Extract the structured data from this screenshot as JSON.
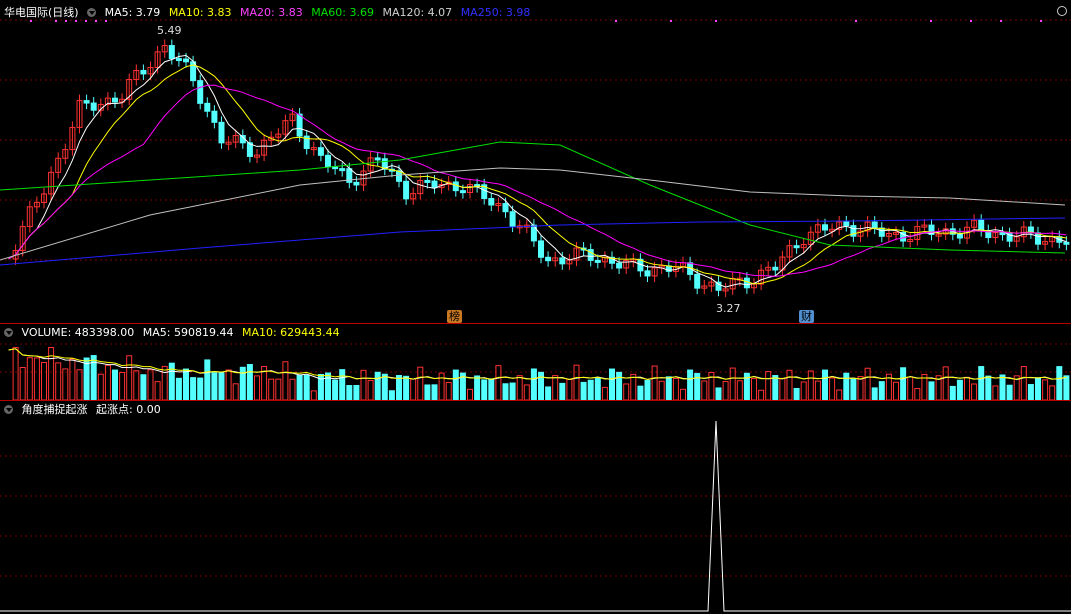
{
  "price": {
    "title": "华电国际(日线)",
    "ma5": "MA5: 3.79",
    "ma10": "MA10: 3.83",
    "ma20": "MA20: 3.83",
    "ma60": "MA60: 3.69",
    "ma120": "MA120: 4.07",
    "ma250": "MA250: 3.98",
    "high_label": "5.49",
    "low_label": "3.27",
    "tag1": "榜",
    "tag2": "财"
  },
  "volume": {
    "title": "VOLUME: 483398.00",
    "ma5": "MA5: 590819.44",
    "ma10": "MA10: 629443.44"
  },
  "indicator": {
    "title": "角度捕捉起涨",
    "value": "起涨点: 0.00"
  },
  "colors": {
    "up": "#ff3232",
    "down": "#54ffff",
    "ma5": "#ffffff",
    "ma10": "#ffff00",
    "ma20": "#ff00ff",
    "ma60": "#00e000",
    "ma120": "#c0c0c0",
    "ma250": "#2020ff"
  }
}
